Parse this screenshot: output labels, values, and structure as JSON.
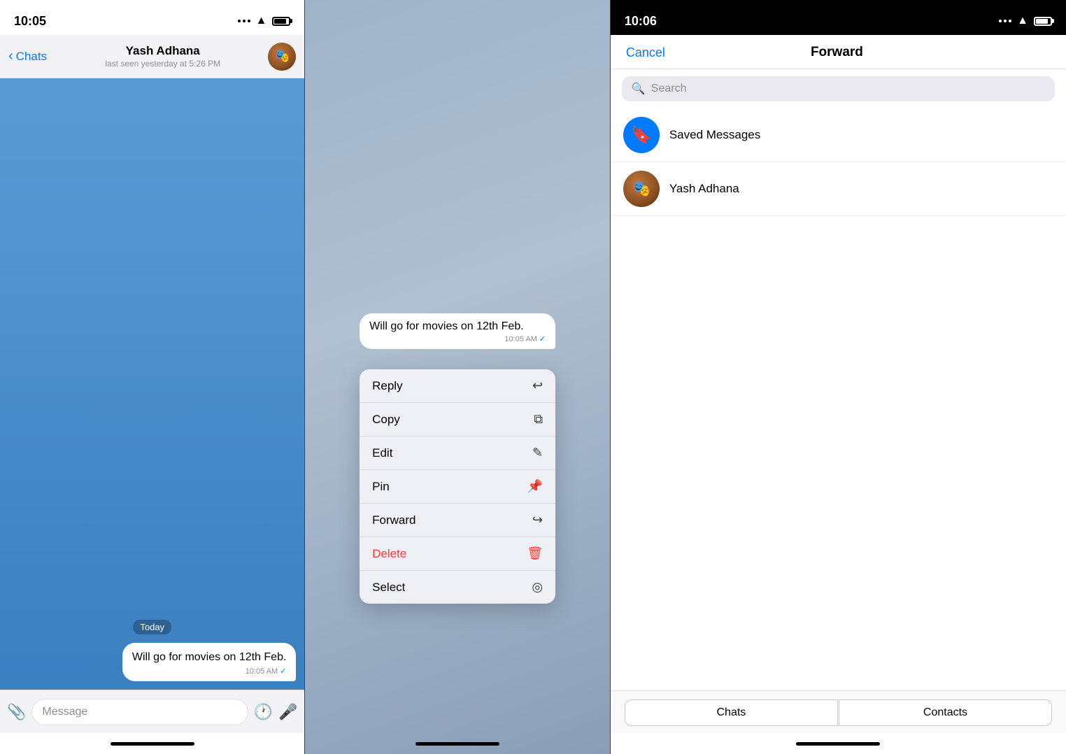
{
  "panel1": {
    "status_time": "10:05",
    "contact_name": "Yash Adhana",
    "contact_status": "last seen yesterday at 5:26 PM",
    "back_label": "Chats",
    "date_badge": "Today",
    "message_text": "Will go for movies on 12th Feb.",
    "message_time": "10:05 AM",
    "input_placeholder": "Message",
    "checkmark": "✓"
  },
  "panel2": {
    "message_text": "Will go for movies on 12th Feb.",
    "message_time": "10:05 AM",
    "context_items": [
      {
        "label": "Reply",
        "icon": "↩"
      },
      {
        "label": "Copy",
        "icon": "⧉"
      },
      {
        "label": "Edit",
        "icon": "✎"
      },
      {
        "label": "Pin",
        "icon": "⊳"
      },
      {
        "label": "Forward",
        "icon": "↪"
      },
      {
        "label": "Delete",
        "icon": "🗑",
        "is_delete": true
      },
      {
        "label": "Select",
        "icon": "◉"
      }
    ]
  },
  "panel3": {
    "status_time": "10:06",
    "cancel_label": "Cancel",
    "title": "Forward",
    "search_placeholder": "Search",
    "contacts": [
      {
        "name": "Saved Messages",
        "type": "saved"
      },
      {
        "name": "Yash Adhana",
        "type": "person"
      }
    ],
    "tabs": [
      "Chats",
      "Contacts"
    ]
  }
}
